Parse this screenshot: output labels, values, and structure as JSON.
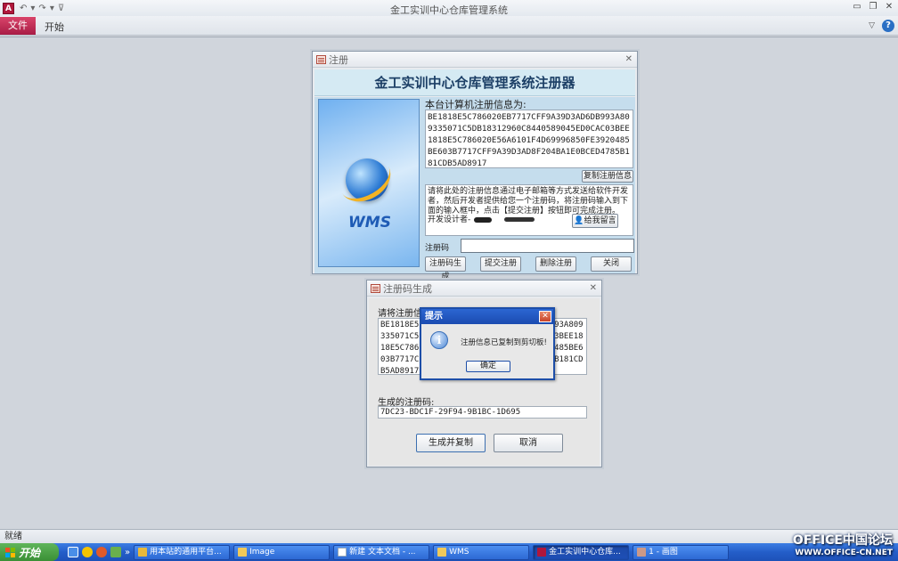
{
  "app": {
    "title": "金工实训中心仓库管理系统",
    "icon_letter": "A"
  },
  "ribbon": {
    "tab_file": "文件",
    "tab_home": "开始"
  },
  "register_window": {
    "title": "注册",
    "header": "金工实训中心仓库管理系统注册器",
    "info_label": "本台计算机注册信息为:",
    "info_value": "BE1818E5C786020EB7717CFF9A39D3AD6DB993A809335071C5DB18312960C8440589045ED0CAC03BEE1818E5C786020E56A6101F4D69996850FE3920485BE603B7717CFF9A39D3AD8F204BA1E0BCED4785B181CDB5AD8917",
    "copy_button": "复制注册信息",
    "description": "请将此处的注册信息通过电子邮箱等方式发送给软件开发者，然后开发者提供给您一个注册码，将注册码输入到下面的输入框中，点击【提交注册】按钮即可完成注册。",
    "developer_label": "开发设计者-",
    "message_button": "给我留言",
    "code_label": "注册码",
    "logo_text": "WMS",
    "buttons": {
      "generate": "注册码生成",
      "submit": "提交注册",
      "delete": "删除注册",
      "close": "关闭"
    }
  },
  "generator_window": {
    "title": "注册码生成",
    "info_label": "请将注册信息输入或粘贴到此处",
    "info_value": "BE1818E5C786020EB7717CFF9A39D3AD6DB993A809335071C5DB18312960C8440589045ED0CAC03BEE1818E5C786020E56A6101F4D69996850FE3920485BE603B7717CFF9A39D3AD8F204BA1E0BCED4785B181CDB5AD8917",
    "code_label": "生成的注册码:",
    "code_value": "7DC23-BDC1F-29F94-9B1BC-1D695",
    "gen_copy_button": "生成并复制",
    "cancel_button": "取消"
  },
  "message_box": {
    "title": "提示",
    "text": "注册信息已复制到剪切板!",
    "ok_button": "确定"
  },
  "statusbar": {
    "text": "就绪"
  },
  "taskbar": {
    "start_label": "开始",
    "quick_more": "»",
    "tasks": [
      {
        "label": "用本站的通用平台..."
      },
      {
        "label": "Image"
      },
      {
        "label": "新建 文本文档 - ..."
      },
      {
        "label": "WMS"
      },
      {
        "label": "金工实训中心仓库..."
      },
      {
        "label": "1 - 画图"
      }
    ]
  },
  "watermark": {
    "line1": "OFFICE中国论坛",
    "line2": "WWW.OFFICE-CN.NET"
  }
}
